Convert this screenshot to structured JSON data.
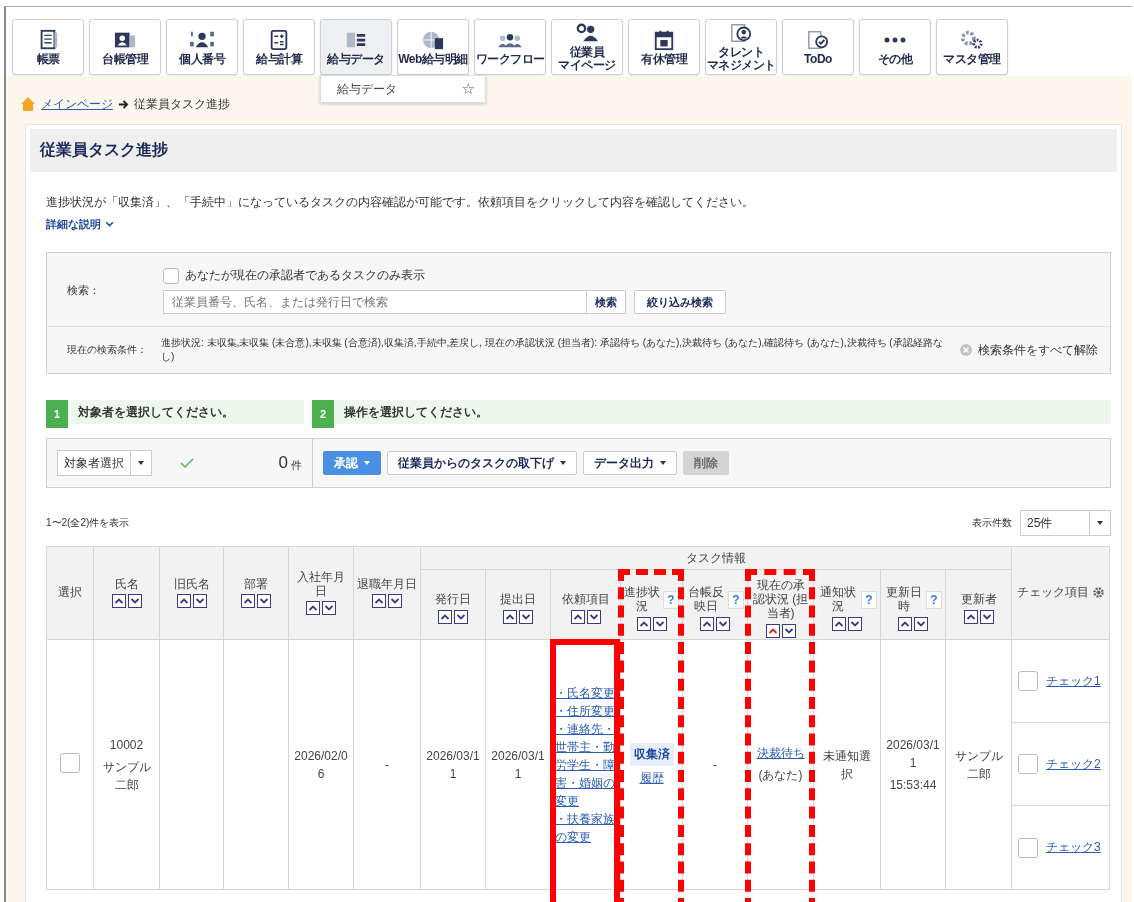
{
  "toolbar": [
    {
      "lines": [
        "帳票"
      ],
      "active": false
    },
    {
      "lines": [
        "台帳管理"
      ],
      "active": false
    },
    {
      "lines": [
        "個人番号"
      ],
      "active": false
    },
    {
      "lines": [
        "給与計算"
      ],
      "active": false
    },
    {
      "lines": [
        "給与データ"
      ],
      "active": true
    },
    {
      "lines": [
        "Web給与明細"
      ],
      "active": false
    },
    {
      "lines": [
        "ワークフロー"
      ],
      "active": false
    },
    {
      "lines": [
        "従業員",
        "マイページ"
      ],
      "active": false
    },
    {
      "lines": [
        "有休管理"
      ],
      "active": false
    },
    {
      "lines": [
        "タレント",
        "マネジメント"
      ],
      "active": false
    },
    {
      "lines": [
        "ToDo"
      ],
      "active": false
    },
    {
      "lines": [
        "その他"
      ],
      "active": false
    },
    {
      "lines": [
        "マスタ管理"
      ],
      "active": false
    }
  ],
  "popup_menu": {
    "label": "給与データ",
    "star": "☆"
  },
  "breadcrumb": {
    "home": "メインページ",
    "current": "従業員タスク進捗"
  },
  "page_title": "従業員タスク進捗",
  "description": "進捗状況が「収集済」、「手続中」になっているタスクの内容確認が可能です。依頼項目をクリックして内容を確認してください。",
  "details_link": {
    "label": "詳細な説明",
    "expanded": false
  },
  "search": {
    "label": "検索：",
    "only_mine": {
      "label": "あなたが現在の承認者であるタスクのみ表示",
      "checked": false
    },
    "placeholder": "従業員番号、氏名、または発行日で検索",
    "search_button": "検索",
    "filter_button": "絞り込み検索",
    "conditions_label": "現在の検索条件：",
    "conditions": "進捗状況: 未収集,未収集 (未合意),未収集 (合意済),収集済,手続中,差戻し, 現在の承認状況 (担当者): 承認待ち (あなた),決裁待ち (あなた),確認待ち (あなた),決裁待ち (承認経路なし)",
    "clear": "検索条件をすべて解除"
  },
  "steps": [
    {
      "number": "1",
      "label": "対象者を選択してください。"
    },
    {
      "number": "2",
      "label": "操作を選択してください。"
    }
  ],
  "actions": {
    "target_select": "対象者選択",
    "count": "0",
    "count_unit": "件",
    "buttons": [
      {
        "label": "承認",
        "kind": "primary",
        "dropdown": true,
        "disabled": false
      },
      {
        "label": "従業員からのタスクの取下げ",
        "kind": "default",
        "dropdown": true,
        "disabled": false
      },
      {
        "label": "データ出力",
        "kind": "default",
        "dropdown": true,
        "disabled": false
      },
      {
        "label": "削除",
        "kind": "default",
        "dropdown": false,
        "disabled": true
      }
    ]
  },
  "result_count": "1〜2(全2)件を表示",
  "page_size": {
    "label": "表示件数",
    "value": "25件"
  },
  "table": {
    "columns_before": [
      {
        "label": "選択"
      },
      {
        "label": "氏名",
        "sorted": false
      },
      {
        "label": "旧氏名",
        "sorted": false
      },
      {
        "label": "部署",
        "sorted": false
      },
      {
        "label": "入社年月日",
        "sorted": false
      },
      {
        "label": "退職年月日",
        "sorted": false
      }
    ],
    "group": {
      "label": "タスク情報",
      "columns": [
        {
          "label": "発行日",
          "sorted": false
        },
        {
          "label": "提出日",
          "sorted": false
        },
        {
          "label": "依頼項目",
          "sorted": false,
          "solid_frame": true
        },
        {
          "label": "進捗状況",
          "sorted": false,
          "help": "?",
          "dashed_frame": true
        },
        {
          "label": "台帳反映日",
          "sorted": false,
          "help": "?"
        },
        {
          "label": "現在の承認状況 (担当者)",
          "sorted": true,
          "dashed_frame": true
        },
        {
          "label": "通知状況",
          "sorted": false,
          "help": "?"
        },
        {
          "label": "更新日時",
          "sorted": false,
          "help": "?"
        },
        {
          "label": "更新者",
          "sorted": false
        }
      ]
    },
    "columns_after": [
      {
        "label": "チェック項目"
      }
    ],
    "rows": [
      {
        "cells": [
          {
            "kind": "checkbox",
            "checked": false
          },
          {
            "kind": "lines",
            "lines": [
              "10002",
              "サンプル二郎"
            ]
          },
          {
            "kind": "empty"
          },
          {
            "kind": "empty"
          },
          {
            "kind": "lines",
            "lines": [
              "2026/02/06"
            ]
          },
          {
            "kind": "lines",
            "lines": [
              "-"
            ]
          },
          {
            "kind": "lines",
            "lines": [
              "2026/03/11"
            ]
          },
          {
            "kind": "lines",
            "lines": [
              "2026/03/11"
            ]
          },
          {
            "kind": "links",
            "links": [
              "・氏名変更",
              "・住所変更",
              "・連絡先・世帯主・勤労学生・障害・婚姻の変更",
              "・扶養家族の変更"
            ]
          },
          {
            "kind": "status",
            "badge": "収集済",
            "link": "履歴"
          },
          {
            "kind": "lines",
            "lines": [
              "-"
            ]
          },
          {
            "kind": "approval",
            "link": "決裁待ち",
            "note": "(あなた)"
          },
          {
            "kind": "lines",
            "lines": [
              "未通知選択"
            ]
          },
          {
            "kind": "lines",
            "lines": [
              "2026/03/11",
              "15:53:44"
            ]
          },
          {
            "kind": "lines",
            "lines": [
              "サンプル二郎"
            ]
          },
          {
            "kind": "checks",
            "items": [
              {
                "label": "チェック1",
                "checked": false
              },
              {
                "label": "チェック2",
                "checked": false
              },
              {
                "label": "チェック3",
                "checked": false
              }
            ]
          }
        ]
      }
    ]
  }
}
